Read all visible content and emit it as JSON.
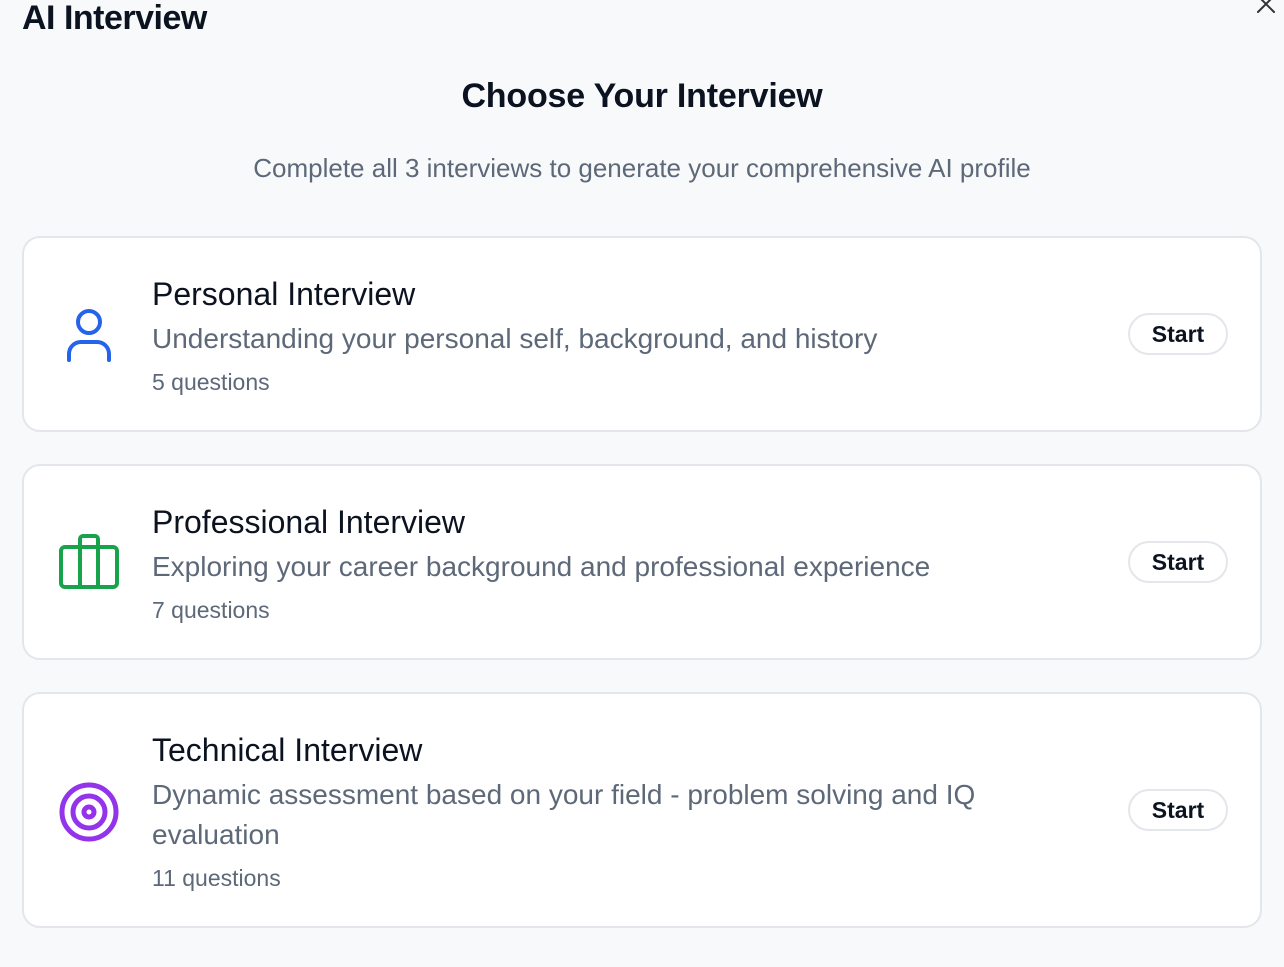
{
  "window": {
    "title": "AI Interview",
    "close_icon": "close-icon"
  },
  "main": {
    "heading": "Choose Your Interview",
    "subheading": "Complete all 3 interviews to generate your comprehensive AI profile"
  },
  "interviews": [
    {
      "title": "Personal Interview",
      "description": "Understanding your personal self, background, and history",
      "questions": "5 questions",
      "button_label": "Start",
      "icon": "user-icon",
      "icon_color": "#2563eb"
    },
    {
      "title": "Professional Interview",
      "description": "Exploring your career background and professional experience",
      "questions": "7 questions",
      "button_label": "Start",
      "icon": "briefcase-icon",
      "icon_color": "#16a34a"
    },
    {
      "title": "Technical Interview",
      "description": "Dynamic assessment based on your field - problem solving and IQ evaluation",
      "questions": "11 questions",
      "button_label": "Start",
      "icon": "target-icon",
      "icon_color": "#9333ea"
    }
  ]
}
